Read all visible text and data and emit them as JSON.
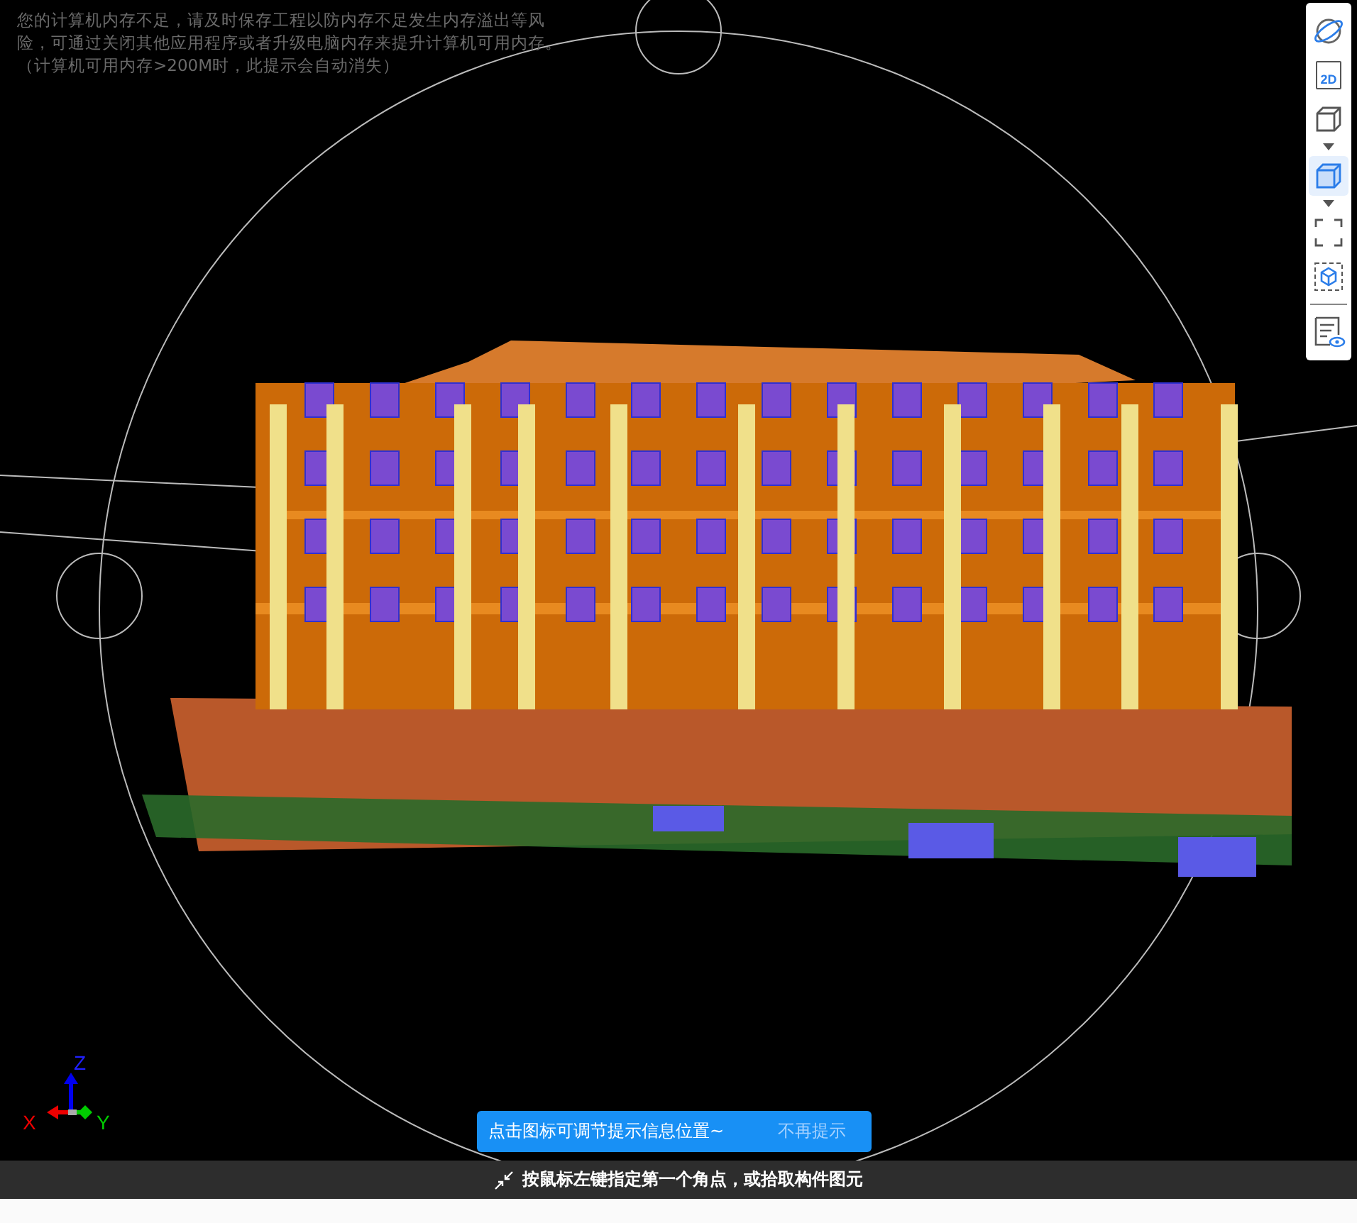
{
  "memory_warning": "您的计算机内存不足，请及时保存工程以防内存不足发生内存溢出等风险，可通过关闭其他应用程序或者升级电脑内存来提升计算机可用内存。（计算机可用内存>200M时，此提示会自动消失）",
  "toolbar": [
    {
      "kind": "orbit",
      "selected": false
    },
    {
      "kind": "label",
      "label": "2D",
      "selected": false
    },
    {
      "kind": "cube",
      "selected": false,
      "dropdown": true
    },
    {
      "kind": "cube",
      "selected": true,
      "dropdown": true
    },
    {
      "kind": "frame",
      "selected": false
    },
    {
      "kind": "boxed-cube",
      "selected": false
    },
    {
      "kind": "divider"
    },
    {
      "kind": "list",
      "selected": false
    }
  ],
  "axis": {
    "x": "X",
    "y": "Y",
    "z": "Z"
  },
  "tooltip": {
    "text": "点击图标可调节提示信息位置~",
    "dismiss": "不再提示"
  },
  "status_bar": {
    "text": "按鼠标左键指定第一个角点，或拾取构件图元"
  }
}
